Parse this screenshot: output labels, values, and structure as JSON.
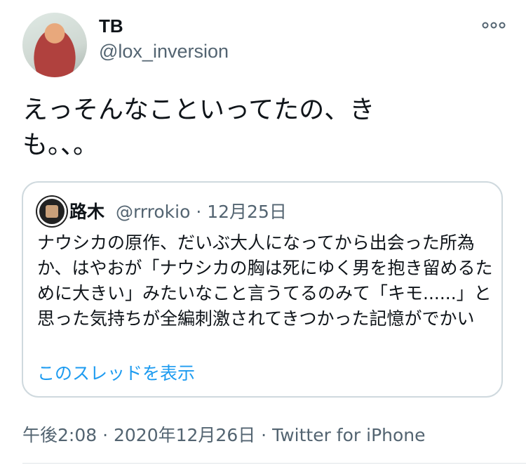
{
  "tweet": {
    "author_name": "TB",
    "author_handle": "@lox_inversion",
    "text": "えっそんなこといってたの、きも。、。",
    "timestamp": "午後2:08 · 2020年12月26日 · Twitter for iPhone"
  },
  "quote": {
    "author_name": "路木",
    "author_handle": "@rrrokio",
    "date": "12月25日",
    "text": "ナウシカの原作、だいぶ大人になってから出会った所為か、はやおが「ナウシカの胸は死にゆく男を抱き留めるために大きい」みたいなこと言うてるのみて「キモ......」と思った気持ちが全編刺激されてきつかった記憶がでかい",
    "thread_link": "このスレッドを表示"
  },
  "icons": {
    "more": "more-options-icon"
  },
  "colors": {
    "link": "#1d9bf0",
    "secondary_text": "#536471",
    "border": "#cfd9de"
  }
}
